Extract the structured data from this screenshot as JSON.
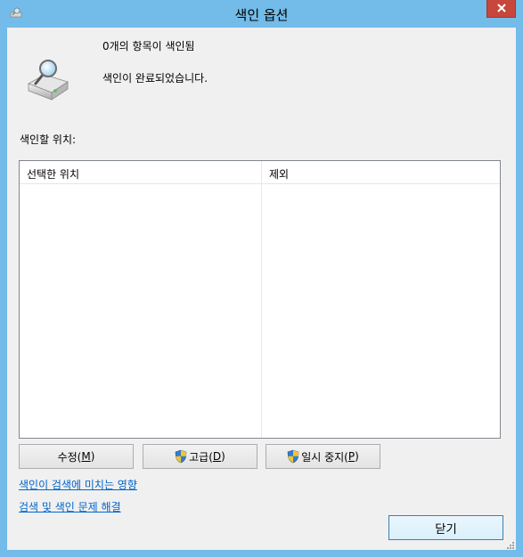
{
  "window": {
    "title": "색인 옵션"
  },
  "status": {
    "items_indexed": "0개의 항목이 색인됨",
    "state": "색인이 완료되었습니다."
  },
  "locations": {
    "label": "색인할 위치:",
    "columns": [
      "선택한 위치",
      "제외"
    ],
    "rows": []
  },
  "buttons": {
    "modify": {
      "label": "수정(",
      "mnemonic": "M",
      "suffix": ")"
    },
    "advanced": {
      "label": "고급(",
      "mnemonic": "D",
      "suffix": ")"
    },
    "pause": {
      "label": "일시 중지(",
      "mnemonic": "P",
      "suffix": ")"
    },
    "close": "닫기"
  },
  "links": {
    "how_affects": "색인이 검색에 미치는 영향",
    "troubleshoot": "검색 및 색인 문제 해결"
  },
  "colors": {
    "frame": "#73bbe8",
    "close_button": "#c7473d",
    "link": "#0066cc"
  },
  "icons": [
    "app-icon",
    "close-icon",
    "drive-search-icon",
    "uac-shield-icon",
    "resize-grip-icon"
  ]
}
